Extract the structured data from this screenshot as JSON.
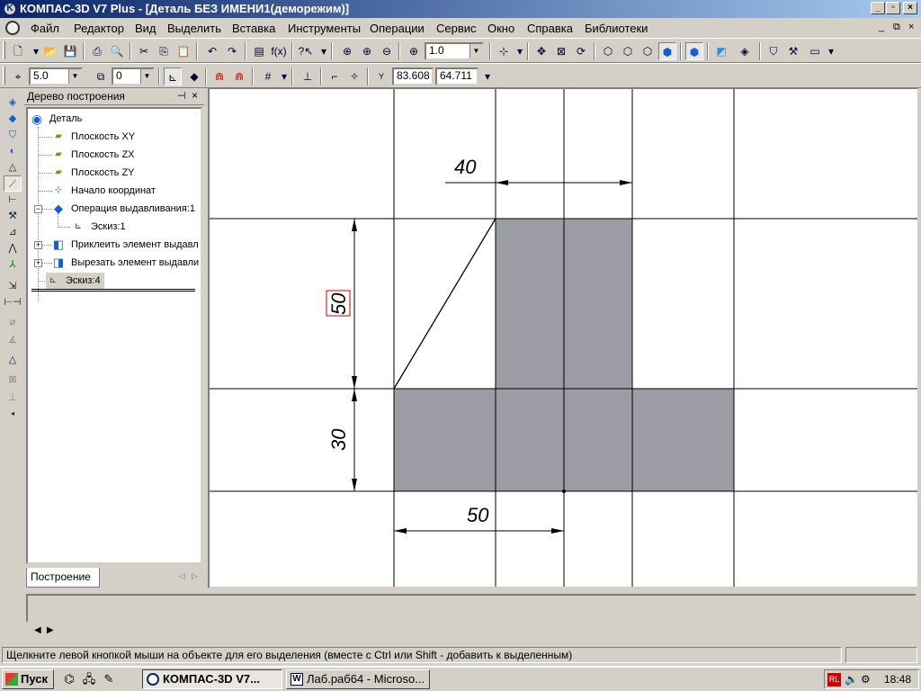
{
  "window": {
    "title": "КОМПАС-3D V7 Plus - [Деталь БЕЗ ИМЕНИ1(деморежим)]",
    "app_icon": "kompas-logo-icon"
  },
  "menu": {
    "items": [
      "Файл",
      "Редактор",
      "Вид",
      "Выделить",
      "Вставка",
      "Инструменты",
      "Операции",
      "Сервис",
      "Окно",
      "Справка",
      "Библиотеки"
    ]
  },
  "toolbar1": {
    "zoom_value": "1.0"
  },
  "toolbar2": {
    "step_value": "5.0",
    "layer_value": "0",
    "coord_label": "Y",
    "coord_x": "83.608",
    "coord_y": "64.711"
  },
  "tree": {
    "header": "Дерево построения",
    "pin_icon": "pin-icon",
    "close_icon": "close-icon",
    "nodes": [
      {
        "label": "Деталь",
        "icon": "detail-icon"
      },
      {
        "label": "Плоскость XY",
        "icon": "plane-icon"
      },
      {
        "label": "Плоскость ZX",
        "icon": "plane-icon"
      },
      {
        "label": "Плоскость ZY",
        "icon": "plane-icon"
      },
      {
        "label": "Начало координат",
        "icon": "origin-icon"
      },
      {
        "label": "Операция выдавливания:1",
        "icon": "extrude-icon"
      },
      {
        "label": "Эскиз:1",
        "icon": "sketch-icon"
      },
      {
        "label": "Приклеить элемент выдавл",
        "icon": "extrude-add-icon"
      },
      {
        "label": "Вырезать элемент выдавли",
        "icon": "extrude-cut-icon"
      },
      {
        "label": "Эскиз:4",
        "icon": "sketch-icon"
      }
    ],
    "tab_label": "Построение"
  },
  "drawing": {
    "dimensions": [
      {
        "label": "40",
        "orientation": "horizontal"
      },
      {
        "label": "50",
        "orientation": "vertical",
        "highlighted": true
      },
      {
        "label": "30",
        "orientation": "vertical"
      },
      {
        "label": "50",
        "orientation": "horizontal"
      }
    ],
    "fill_color": "#9c9ca4",
    "line_color": "#000000"
  },
  "status": {
    "text": "Щелкните левой кнопкой мыши на объекте для его выделения (вместе с Ctrl или Shift - добавить к выделенным)"
  },
  "taskbar": {
    "start_label": "Пуск",
    "tasks": [
      {
        "label": "КОМПАС-3D V7...",
        "active": true
      },
      {
        "label": "Лаб.раб64 - Microso...",
        "active": false
      }
    ],
    "tray_lang": "RL",
    "clock": "18:48"
  }
}
